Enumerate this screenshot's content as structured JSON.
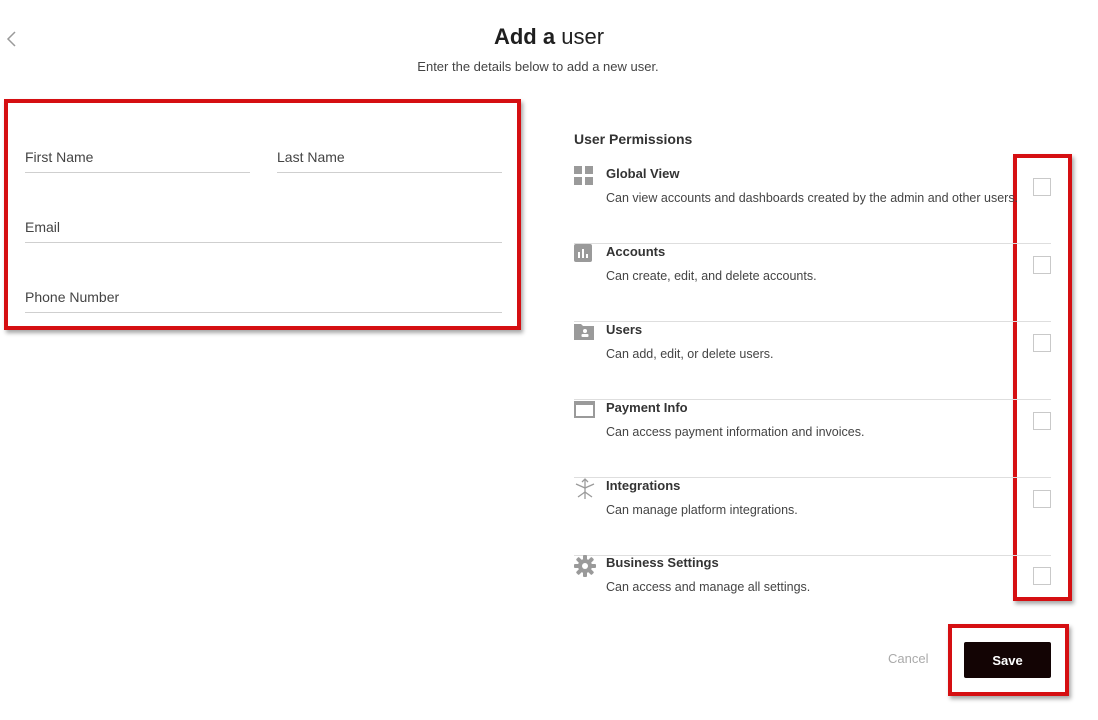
{
  "header": {
    "title_bold": "Add a",
    "title_light": "user",
    "subtitle": "Enter the details below to add a new user."
  },
  "form": {
    "first_name": {
      "placeholder": "First Name",
      "value": ""
    },
    "last_name": {
      "placeholder": "Last Name",
      "value": ""
    },
    "email": {
      "placeholder": "Email",
      "value": ""
    },
    "phone": {
      "placeholder": "Phone Number",
      "value": ""
    }
  },
  "permissions": {
    "title": "User Permissions",
    "items": [
      {
        "name": "Global View",
        "description": "Can view accounts and dashboards created by the admin and other users.",
        "icon": "grid-icon",
        "checked": false
      },
      {
        "name": "Accounts",
        "description": "Can create, edit, and delete accounts.",
        "icon": "bar-chart-icon",
        "checked": false
      },
      {
        "name": "Users",
        "description": "Can add, edit, or delete users.",
        "icon": "user-folder-icon",
        "checked": false
      },
      {
        "name": "Payment Info",
        "description": "Can access payment information and invoices.",
        "icon": "window-icon",
        "checked": false
      },
      {
        "name": "Integrations",
        "description": "Can manage platform integrations.",
        "icon": "integrations-icon",
        "checked": false
      },
      {
        "name": "Business Settings",
        "description": "Can access and manage all settings.",
        "icon": "gear-icon",
        "checked": false
      }
    ]
  },
  "actions": {
    "cancel_label": "Cancel",
    "save_label": "Save"
  },
  "colors": {
    "highlight": "#d50f12",
    "save_bg": "#130404",
    "icon": "#9a9a9a"
  }
}
